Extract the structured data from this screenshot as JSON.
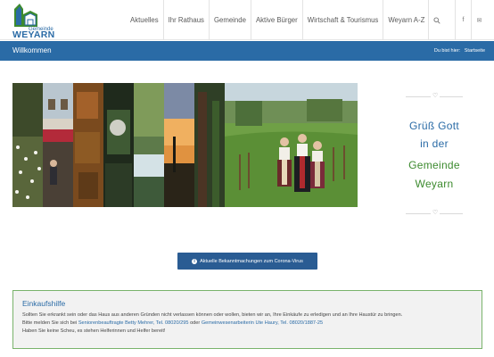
{
  "logo": {
    "small_text": "Gemeinde",
    "big_text": "WEYARN"
  },
  "nav": {
    "items": [
      "Aktuelles",
      "Ihr Rathaus",
      "Gemeinde",
      "Aktive Bürger",
      "Wirtschaft & Tourismus",
      "Weyarn A-Z"
    ],
    "search_icon": "search-icon",
    "social": [
      {
        "icon": "facebook-icon",
        "glyph": "f"
      },
      {
        "icon": "mail-icon",
        "glyph": "✉"
      }
    ]
  },
  "titlebar": {
    "title": "Willkommen",
    "breadcrumb_prefix": "Du bist hier:",
    "breadcrumb_current": "Startseite"
  },
  "greeting": {
    "lines": [
      "Grüß Gott",
      "in der",
      "Gemeinde",
      "Weyarn"
    ],
    "colors": [
      "#2a6ba6",
      "#2a6ba6",
      "#3c8a2e",
      "#3c8a2e"
    ],
    "divider_icon": "heart-icon"
  },
  "corona_button": {
    "label": "Aktuelle Bekanntmachungen zum Corona-Virus",
    "icon": "info-icon"
  },
  "einkaufshilfe": {
    "title": "Einkaufshilfe",
    "line1": "Sollten Sie erkrankt sein oder das Haus aus anderen Gründen nicht verlassen können oder wollen, bieten wir an, Ihre Einkäufe zu erledigen und an Ihre Haustür zu bringen.",
    "line2_prefix": "Bitte melden Sie sich bei",
    "contact1": "Seniorenbeauftragte Betty Mehrer, Tel. 08020/295",
    "line2_mid": "oder",
    "contact2": "Gemeinwesenarbeiterin Ute Haury, Tel. 08020/1887-25",
    "line3": "Haben Sie keine Scheu, es stehen Helferinnen und Helfer bereit!"
  },
  "colors": {
    "brand_blue": "#2a6ba6",
    "button_blue": "#2a5c93",
    "green": "#3c8a2e",
    "box_border": "#79b36b"
  }
}
